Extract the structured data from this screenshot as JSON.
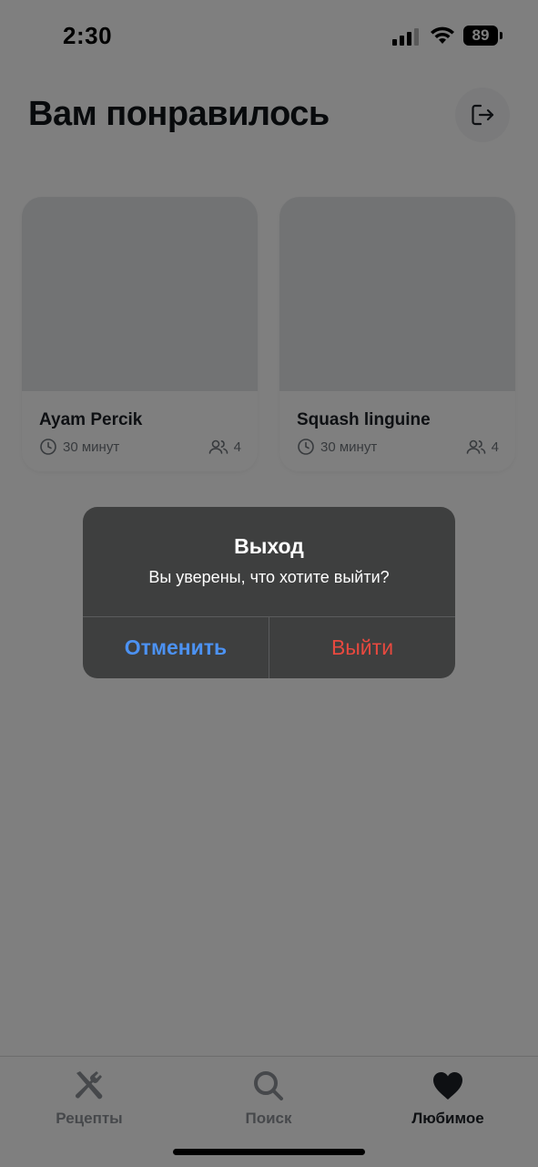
{
  "status_bar": {
    "time": "2:30",
    "battery": "89"
  },
  "header": {
    "title": "Вам понравилось",
    "logout_icon": "logout-icon"
  },
  "recipes": [
    {
      "title": "Ayam Percik",
      "time": "30 минут",
      "servings": "4"
    },
    {
      "title": "Squash linguine",
      "time": "30 минут",
      "servings": "4"
    }
  ],
  "tabs": [
    {
      "label": "Рецепты",
      "icon": "fork-knife-icon",
      "active": false
    },
    {
      "label": "Поиск",
      "icon": "search-icon",
      "active": false
    },
    {
      "label": "Любимое",
      "icon": "heart-icon",
      "active": true
    }
  ],
  "alert": {
    "title": "Выход",
    "message": "Вы уверены, что хотите выйти?",
    "cancel_label": "Отменить",
    "confirm_label": "Выйти"
  },
  "colors": {
    "accent_blue": "#4c92f3",
    "destructive_red": "#e8493f",
    "alert_background": "#3e3f3f",
    "text_dark": "#1d2127"
  }
}
